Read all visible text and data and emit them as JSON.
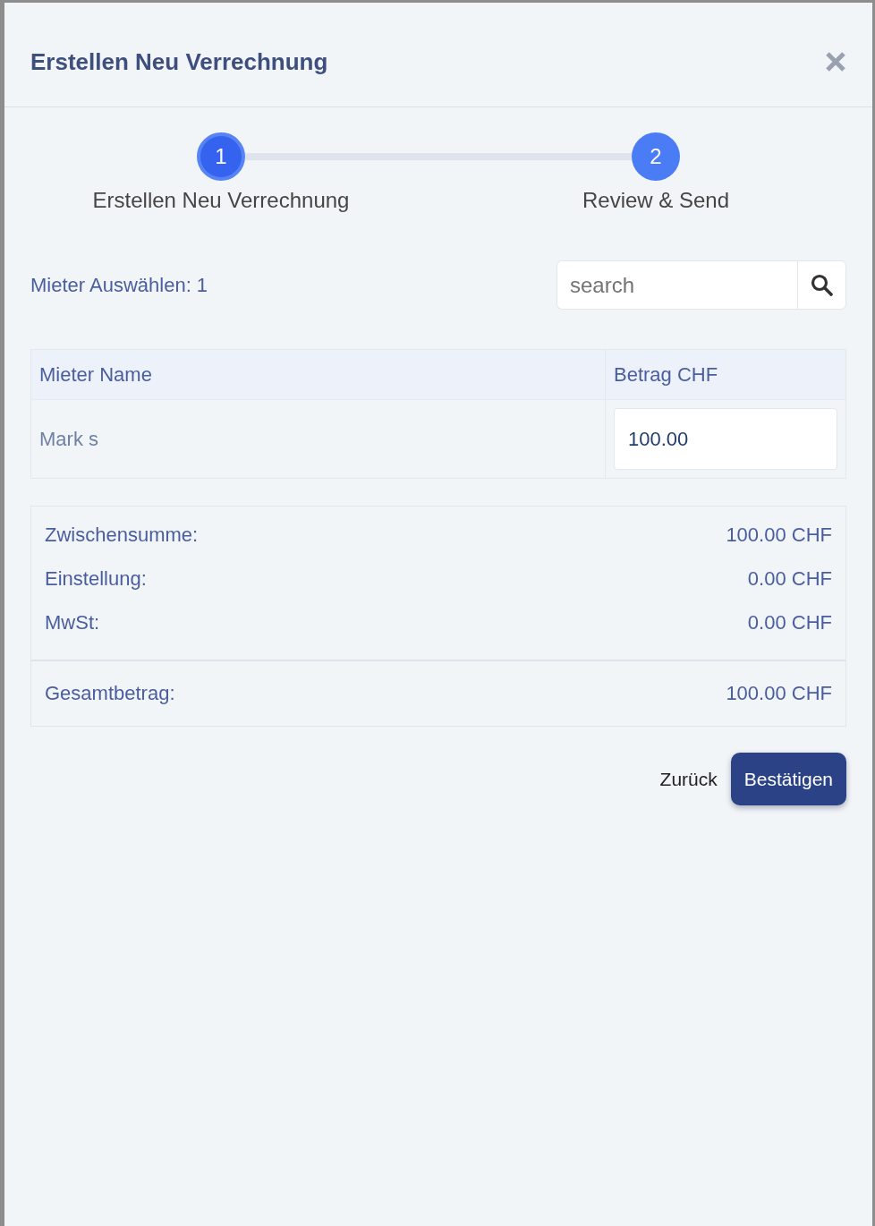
{
  "dialog": {
    "title": "Erstellen Neu Verrechnung"
  },
  "steps": [
    {
      "number": "1",
      "label": "Erstellen Neu Verrechnung",
      "selected": true
    },
    {
      "number": "2",
      "label": "Review & Send",
      "selected": false
    }
  ],
  "tenant_picker": {
    "label": "Mieter Auswählen: 1",
    "search": {
      "placeholder": "search"
    }
  },
  "table": {
    "columns": [
      "Mieter Name",
      "Betrag CHF"
    ],
    "rows": [
      {
        "name": "Mark s",
        "amount": "100.00"
      }
    ]
  },
  "summary": {
    "rows": [
      {
        "label": "Zwischensumme:",
        "value": "100.00 CHF"
      },
      {
        "label": "Einstellung:",
        "value": "0.00 CHF"
      },
      {
        "label": "MwSt:",
        "value": "0.00 CHF"
      }
    ],
    "total": {
      "label": "Gesamtbetrag:",
      "value": "100.00 CHF"
    }
  },
  "buttons": [
    {
      "label": "Zurück",
      "kind": "link"
    },
    {
      "label": "Bestätigen",
      "kind": "primary"
    }
  ]
}
